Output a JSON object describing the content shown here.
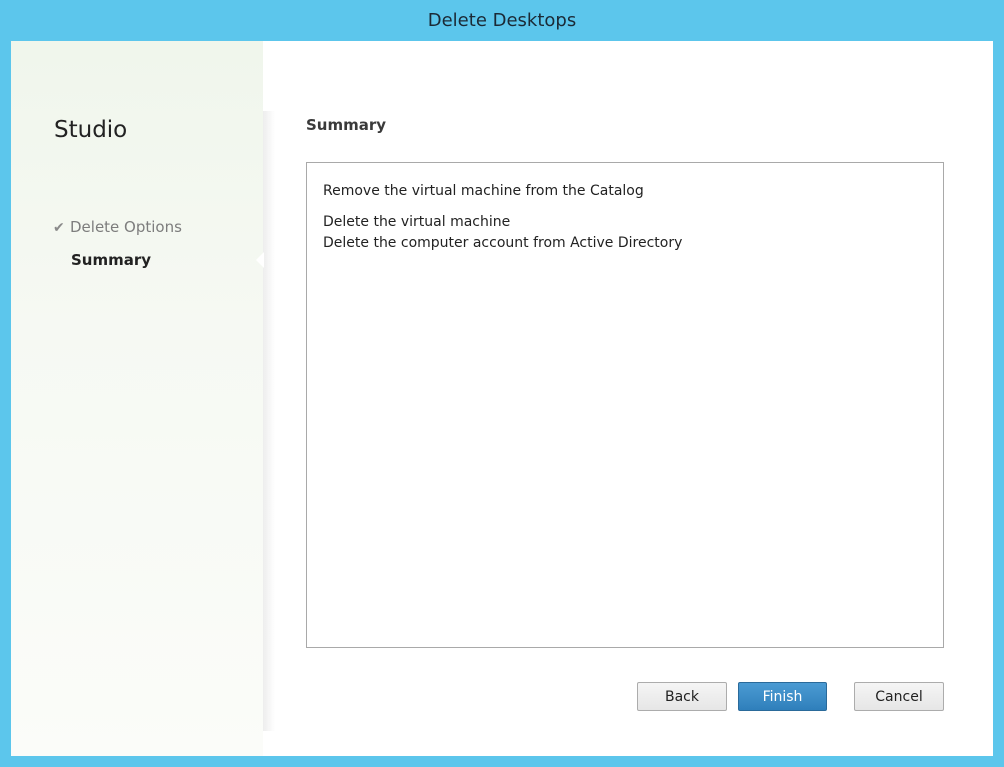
{
  "window": {
    "title": "Delete Desktops",
    "accent_color": "#5cc6ec"
  },
  "sidebar": {
    "brand": "Studio",
    "steps": [
      {
        "label": "Delete Options",
        "state": "completed",
        "icon": "checkmark-icon",
        "icon_glyph": "✔"
      },
      {
        "label": "Summary",
        "state": "current"
      }
    ]
  },
  "main": {
    "title": "Summary",
    "summary_lines": [
      "Remove the virtual machine from the Catalog",
      "Delete the virtual machine",
      "Delete the computer account from Active Directory"
    ]
  },
  "buttons": {
    "back": "Back",
    "finish": "Finish",
    "cancel": "Cancel",
    "primary_color": "#2f7fbb"
  }
}
